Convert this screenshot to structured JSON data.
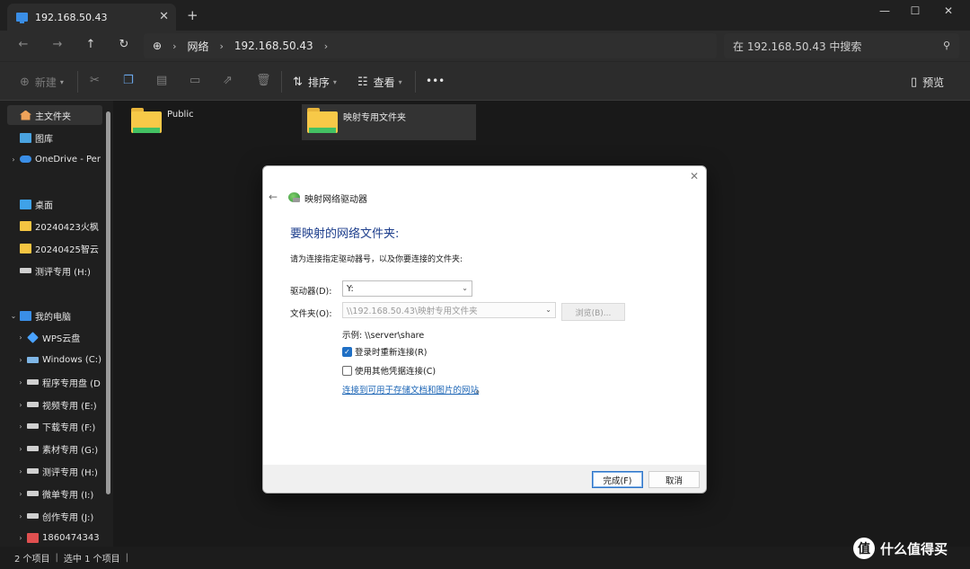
{
  "tab": {
    "title": "192.168.50.43"
  },
  "window_controls": {
    "minimize": "—",
    "maximize": "☐",
    "close": "✕"
  },
  "nav": {
    "back": "←",
    "forward": "→",
    "up": "↑",
    "refresh": "↻",
    "address": [
      "网络",
      "192.168.50.43"
    ],
    "search_placeholder": "在 192.168.50.43 中搜索"
  },
  "toolbar": {
    "new_label": "新建",
    "sort_label": "排序",
    "view_label": "查看",
    "more_label": "•••",
    "preview_label": "预览"
  },
  "sidebar": {
    "items": [
      {
        "label": "主文件夹",
        "icon": "home-icon"
      },
      {
        "label": "图库",
        "icon": "gallery-icon"
      },
      {
        "label": "OneDrive - Per",
        "icon": "onedrive-icon"
      },
      {
        "label": "桌面",
        "icon": "desktop-icon"
      },
      {
        "label": "20240423火枫",
        "icon": "folder-icon"
      },
      {
        "label": "20240425智云",
        "icon": "folder-icon"
      },
      {
        "label": "测评专用 (H:)",
        "icon": "drive-icon"
      },
      {
        "label": "我的电脑",
        "icon": "computer-icon"
      },
      {
        "label": "WPS云盘",
        "icon": "wps-icon"
      },
      {
        "label": "Windows (C:)",
        "icon": "windows-drive-icon"
      },
      {
        "label": "程序专用盘 (D",
        "icon": "drive-icon"
      },
      {
        "label": "视频专用 (E:)",
        "icon": "drive-icon"
      },
      {
        "label": "下载专用 (F:)",
        "icon": "drive-icon"
      },
      {
        "label": "素材专用 (G:)",
        "icon": "drive-icon"
      },
      {
        "label": "测评专用 (H:)",
        "icon": "drive-icon"
      },
      {
        "label": "微单专用 (I:)",
        "icon": "drive-icon"
      },
      {
        "label": "创作专用 (J:)",
        "icon": "drive-icon"
      },
      {
        "label": "1860474343",
        "icon": "network-drive-icon"
      }
    ]
  },
  "files": [
    {
      "name": "Public"
    },
    {
      "name": "映射专用文件夹"
    }
  ],
  "status": {
    "count": "2 个项目",
    "selected": "选中 1 个项目"
  },
  "dialog": {
    "title": "映射网络驱动器",
    "heading": "要映射的网络文件夹:",
    "instruction": "请为连接指定驱动器号，以及你要连接的文件夹:",
    "drive_label": "驱动器(D):",
    "drive_value": "Y:",
    "folder_label": "文件夹(O):",
    "folder_value": "\\\\192.168.50.43\\映射专用文件夹",
    "browse_label": "浏览(B)...",
    "example": "示例: \\\\server\\share",
    "reconnect_label": "登录时重新连接(R)",
    "reconnect_checked": true,
    "other_cred_label": "使用其他凭据连接(C)",
    "other_cred_checked": false,
    "link_text": "连接到可用于存储文档和图片的网站",
    "link_suffix": "。",
    "finish_label": "完成(F)",
    "cancel_label": "取消"
  },
  "watermark": {
    "badge": "值",
    "text": "什么值得买"
  }
}
